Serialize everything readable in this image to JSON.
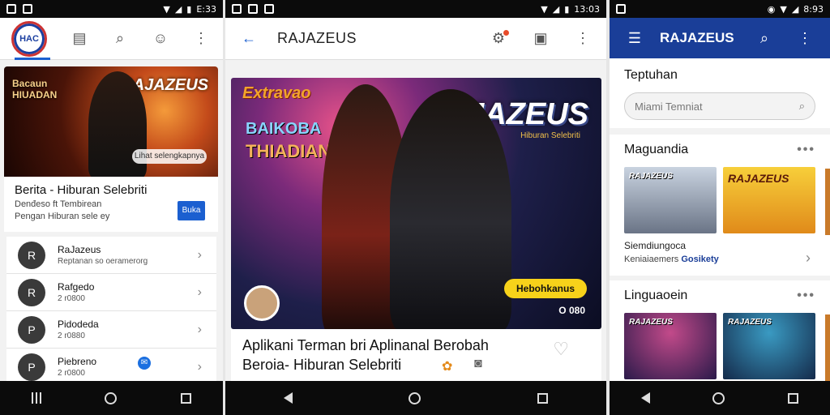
{
  "status": {
    "p1_time": "E:33",
    "p2_time": "13:03",
    "p3_time": "8:93"
  },
  "panel1": {
    "logo_text": "HAC",
    "hero": {
      "left_text_line1": "Bacaun",
      "left_text_line2": "HIUADAN",
      "right_text": "RAJAZEUS",
      "pill": "Lihat selengkapnya"
    },
    "card": {
      "title": "Berita - Hiburan Selebriti",
      "sub1": "Denđeso ft Tembirean",
      "sub2": "Pengan Hiburan sele ey",
      "button": "Buka"
    },
    "list": [
      {
        "name": "RaJazeus",
        "sub": "Reptanan so oeramerorg",
        "avatar": "R"
      },
      {
        "name": "Rafgedo",
        "sub": "2 r0800",
        "avatar": "R"
      },
      {
        "name": "Pidodeda",
        "sub": "2 r0880",
        "avatar": "P"
      },
      {
        "name": "Piebreno",
        "sub": "2 r0800",
        "avatar": "P"
      }
    ]
  },
  "panel2": {
    "title": "RAJAZEUS",
    "hero": {
      "top_left": "Extravao",
      "line_blue": "BAIKOBA",
      "line_orange": "THIADIAN",
      "brand": "RAJAZEUS",
      "brand_sub": "Hiburan Selebriti",
      "yellow_badge": "Hebohkanus",
      "count": "O 080"
    },
    "caption_line1": "Aplikani Terman bri Aplinanal Berobah",
    "caption_line2": "Beroia- Hiburan Selebriti"
  },
  "panel3": {
    "title": "RAJAZEUS",
    "search_heading": "Teptuhan",
    "search_placeholder": "Miami Temniat",
    "section1": {
      "heading": "Maguandia",
      "thumb1": "RAJAZEUS",
      "thumb2": "RAJAZEUS",
      "meta_title": "Siemdiungoca",
      "meta_sub_prefix": "Keniaiaemers",
      "meta_sub_link": "Gosikety"
    },
    "section2": {
      "heading": "Linguaoein",
      "thumb1": "RAJAZEUS",
      "thumb2": "RAJAZEUS"
    }
  }
}
